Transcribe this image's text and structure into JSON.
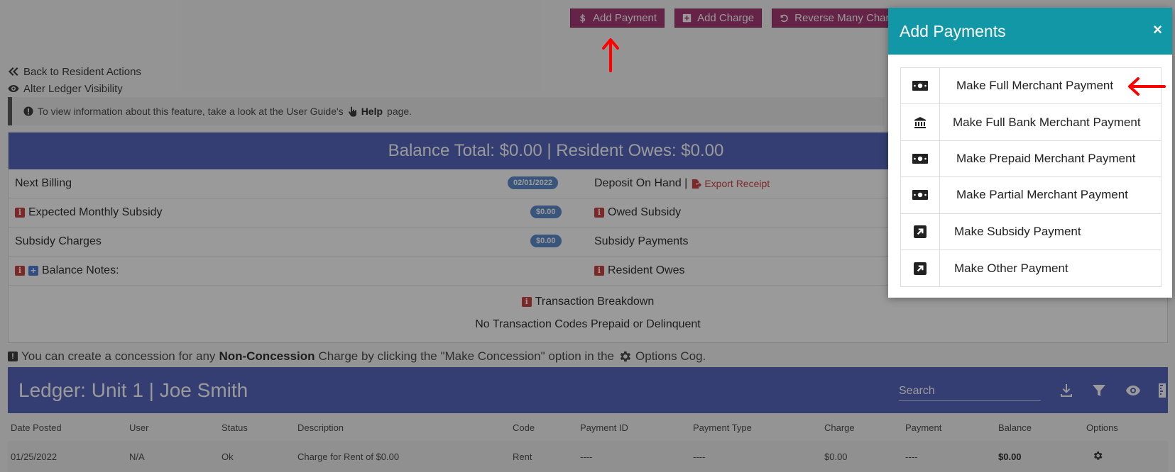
{
  "top_actions": {
    "add_payment": "Add Payment",
    "add_charge": "Add Charge",
    "reverse_many": "Reverse Many Charges"
  },
  "links": {
    "back": "Back to Resident Actions",
    "alter_visibility": "Alter Ledger Visibility"
  },
  "info_banner": {
    "prefix": "To view information about this feature, take a look at the User Guide's",
    "help": "Help",
    "suffix": "page."
  },
  "balance": {
    "header": "Balance Total: $0.00 | Resident Owes: $0.00",
    "rows": [
      {
        "left_label": "Next Billing",
        "pill": "02/01/2022",
        "right_label": "Deposit On Hand |",
        "right_link": "Export Receipt"
      },
      {
        "left_label": "Expected Monthly Subsidy",
        "pill": "$0.00",
        "right_label": "Owed Subsidy"
      },
      {
        "left_label": "Subsidy Charges",
        "pill": "$0.00",
        "right_label": "Subsidy Payments"
      },
      {
        "left_label": "Balance Notes:",
        "right_label": "Resident Owes"
      }
    ],
    "transaction_breakdown": "Transaction Breakdown",
    "no_codes": "No Transaction Codes Prepaid or Delinquent"
  },
  "concession_note": {
    "prefix": "You can create a concession for any",
    "bold": "Non-Concession",
    "middle": "Charge by clicking the \"Make Concession\" option in the",
    "suffix": "Options Cog."
  },
  "ledger": {
    "title": "Ledger: Unit 1 | Joe Smith",
    "search_placeholder": "Search",
    "columns": [
      "Date Posted",
      "User",
      "Status",
      "Description",
      "Code",
      "Payment ID",
      "Payment Type",
      "Charge",
      "Payment",
      "Balance",
      "Options"
    ],
    "rows": [
      {
        "date": "01/25/2022",
        "user": "N/A",
        "status": "Ok",
        "description": "Charge for Rent of $0.00",
        "code": "Rent",
        "payment_id": "----",
        "payment_type": "----",
        "charge": "$0.00",
        "payment": "----",
        "balance": "$0.00"
      }
    ]
  },
  "modal": {
    "title": "Add Payments",
    "close": "×",
    "items": [
      {
        "label": "Make Full Merchant Payment",
        "icon": "money-bill-icon"
      },
      {
        "label": "Make Full Bank Merchant Payment",
        "icon": "bank-icon"
      },
      {
        "label": "Make Prepaid Merchant Payment",
        "icon": "money-bill-icon"
      },
      {
        "label": "Make Partial Merchant Payment",
        "icon": "money-bill-icon"
      },
      {
        "label": "Make Subsidy Payment",
        "icon": "external-link-icon"
      },
      {
        "label": "Make Other Payment",
        "icon": "external-link-icon"
      }
    ]
  },
  "colors": {
    "accent_maroon": "#9c1f63",
    "header_blue": "#3f51b5",
    "modal_teal": "#1297a6",
    "annotation_red": "#ff0000"
  }
}
